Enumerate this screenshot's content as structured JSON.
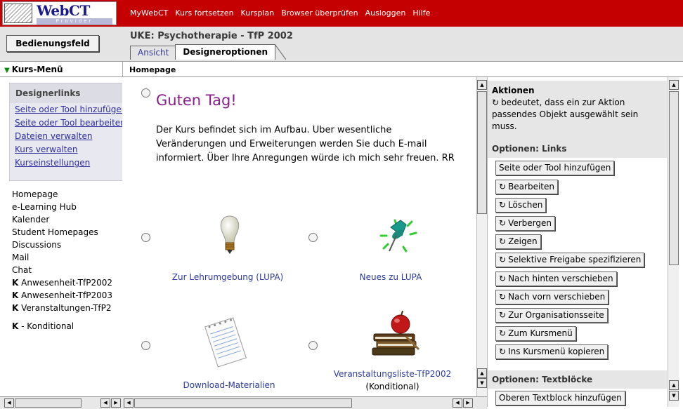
{
  "logo": {
    "brand": "WebCT",
    "sub": "Provider"
  },
  "topnav": [
    "MyWebCT",
    "Kurs fortsetzen",
    "Kursplan",
    "Browser überprüfen",
    "Ausloggen",
    "Hilfe"
  ],
  "header": {
    "panel_button": "Bedienungsfeld",
    "course_title": "UKE: Psychotherapie - TfP 2002",
    "tabs": [
      "Ansicht",
      "Designeroptionen"
    ]
  },
  "menubar": {
    "kursmenu": "Kurs-Menü",
    "breadcrumb": "Homepage"
  },
  "sidebar": {
    "designer_title": "Designerlinks",
    "designer_links": [
      "Seite oder Tool hinzufügen",
      "Seite oder Tool bearbeiten",
      "Dateien verwalten",
      "Kurs verwalten",
      "Kurseinstellungen"
    ],
    "pages": [
      {
        "marker": "",
        "label": "Homepage"
      },
      {
        "marker": "",
        "label": "e-Learning Hub"
      },
      {
        "marker": "",
        "label": "Kalender"
      },
      {
        "marker": "",
        "label": "Student Homepages"
      },
      {
        "marker": "",
        "label": "Discussions"
      },
      {
        "marker": "",
        "label": "Mail"
      },
      {
        "marker": "",
        "label": "Chat"
      },
      {
        "marker": "K",
        "label": "Anwesenheit-TfP2002"
      },
      {
        "marker": "K",
        "label": "Anwesenheit-TfP2003"
      },
      {
        "marker": "K",
        "label": "Veranstaltungen-TfP2"
      },
      {
        "marker": "K",
        "label": "- Konditional"
      }
    ]
  },
  "main": {
    "greeting": "Guten Tag!",
    "intro": "Der Kurs befindet sich im Aufbau. Uber wesentliche Veränderungen und Erweiterungen werden Sie duch E-mail informiert. Über Ihre Anregungen würde ich mich sehr freuen. RR",
    "tiles": [
      {
        "label": "Zur Lehrumgebung (LUPA)",
        "sub": "",
        "icon": "lightbulb-icon"
      },
      {
        "label": "Neues zu LUPA",
        "sub": "",
        "icon": "pushpin-icon"
      },
      {
        "label": "Download-Materialien",
        "sub": "",
        "icon": "notepad-icon"
      },
      {
        "label": "Veranstaltungsliste-TfP2002",
        "sub": "(Konditional)",
        "icon": "books-apple-icon"
      }
    ]
  },
  "actions": {
    "title": "Aktionen",
    "note": "bedeutet, dass ein zur Aktion passendes Objekt ausgewählt sein muss.",
    "links_title": "Optionen: Links",
    "link_buttons": [
      {
        "label": "Seite oder Tool hinzufügen",
        "needs_selection": false
      },
      {
        "label": "Bearbeiten",
        "needs_selection": true
      },
      {
        "label": "Löschen",
        "needs_selection": true
      },
      {
        "label": "Verbergen",
        "needs_selection": true
      },
      {
        "label": "Zeigen",
        "needs_selection": true
      },
      {
        "label": "Selektive Freigabe spezifizieren",
        "needs_selection": true
      },
      {
        "label": "Nach hinten verschieben",
        "needs_selection": true
      },
      {
        "label": "Nach vorn verschieben",
        "needs_selection": true
      },
      {
        "label": "Zur Organisationsseite",
        "needs_selection": true
      },
      {
        "label": "Zum Kursmenü",
        "needs_selection": true
      },
      {
        "label": "Ins Kursmenü kopieren",
        "needs_selection": true
      }
    ],
    "text_title": "Optionen: Textblöcke",
    "text_buttons": [
      {
        "label": "Oberen Textblock hinzufügen",
        "needs_selection": false
      }
    ]
  },
  "colors": {
    "topbar": "#c50000",
    "link": "#2f2f9f",
    "greeting": "#8a1e8a"
  }
}
